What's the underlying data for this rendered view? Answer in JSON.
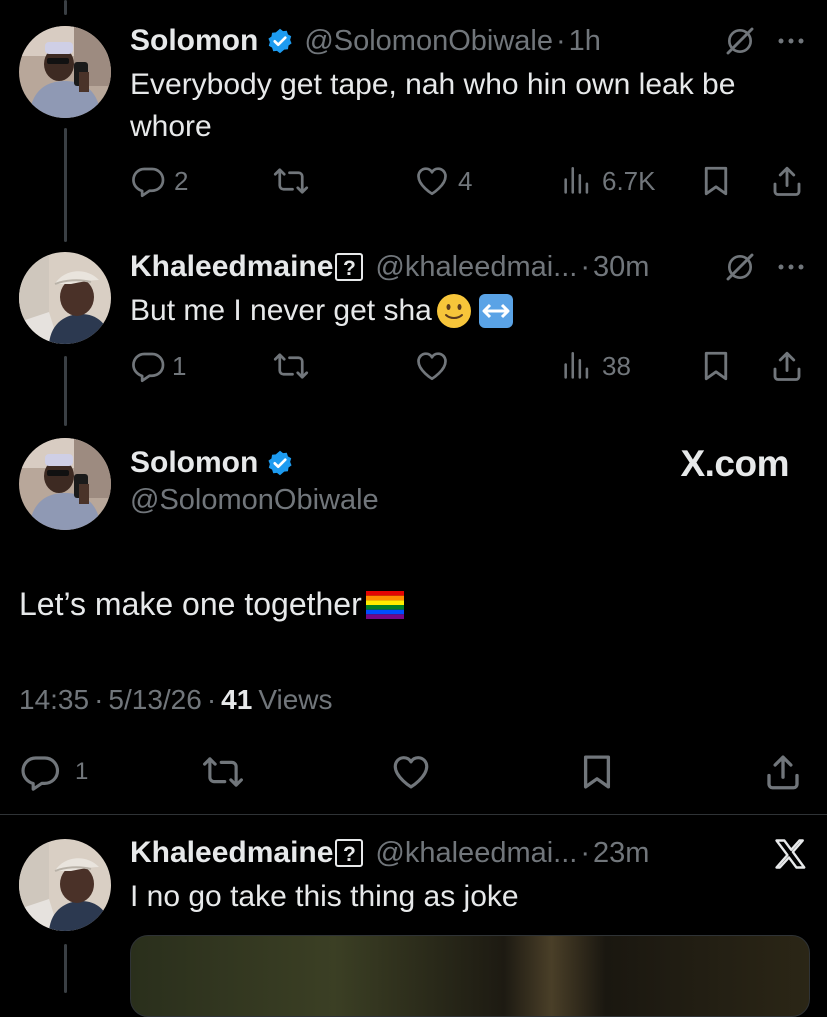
{
  "tweets": [
    {
      "name": "Solomon",
      "handle": "@SolomonObiwale",
      "sep": "·",
      "time": "1h",
      "text_line1": "Everybody get tape, nah who hin own leak be",
      "text_line2": "whore",
      "replies": "2",
      "likes": "4",
      "views": "6.7K",
      "verified": true
    },
    {
      "name": "Khaleedmaine",
      "name_badge": "?",
      "handle": "@khaleedmai...",
      "sep": "·",
      "time": "30m",
      "text": "But me I never get sha",
      "replies": "1",
      "views": "38"
    }
  ],
  "main_tweet": {
    "name": "Solomon",
    "handle": "@SolomonObiwale",
    "watermark": "X.com",
    "text": "Let’s make one together",
    "time": "14:35",
    "date": "5/13/26",
    "views_count": "41",
    "views_label": "Views",
    "replies": "1"
  },
  "reply": {
    "name": "Khaleedmaine",
    "name_badge": "?",
    "handle": "@khaleedmai...",
    "sep": "·",
    "time": "23m",
    "text": "I no go take this thing as joke"
  },
  "icons": {
    "verified_color": "#1d9bf0",
    "dot": "·"
  }
}
